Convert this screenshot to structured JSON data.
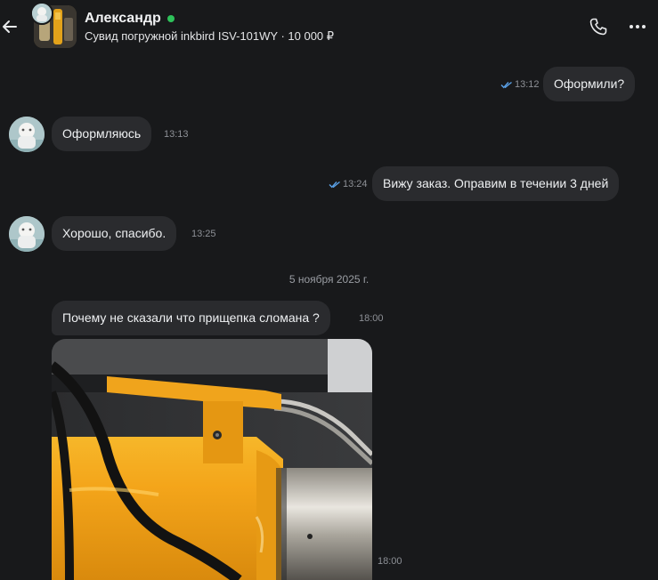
{
  "header": {
    "contact_name": "Александр",
    "listing_subtitle": "Сувид погружной inkbird ISV-101WY · 10 000 ₽",
    "online_color": "#2ec25a"
  },
  "icons": {
    "back": "arrow-left-icon",
    "call": "phone-icon",
    "more": "more-horizontal-icon",
    "read": "double-check-icon"
  },
  "messages": [
    {
      "side": "outgoing",
      "text": "Оформили?",
      "time": "13:12",
      "read": true
    },
    {
      "side": "incoming",
      "text": "Оформляюсь",
      "time": "13:13"
    },
    {
      "side": "outgoing",
      "text": "Вижу заказ. Оправим в течении 3 дней",
      "time": "13:24",
      "read": true
    },
    {
      "side": "incoming",
      "text": "Хорошо, спасибо.",
      "time": "13:25"
    }
  ],
  "date_separator": "5 ноября 2025 г.",
  "later_messages": [
    {
      "side": "incoming",
      "text": "Почему не сказали что прищепка сломана ?",
      "time": "18:00"
    },
    {
      "side": "incoming",
      "type": "photo",
      "time": "18:00"
    }
  ],
  "colors": {
    "background": "#18191b",
    "bubble": "#2a2b2e",
    "read_ticks": "#5aa0e6"
  }
}
